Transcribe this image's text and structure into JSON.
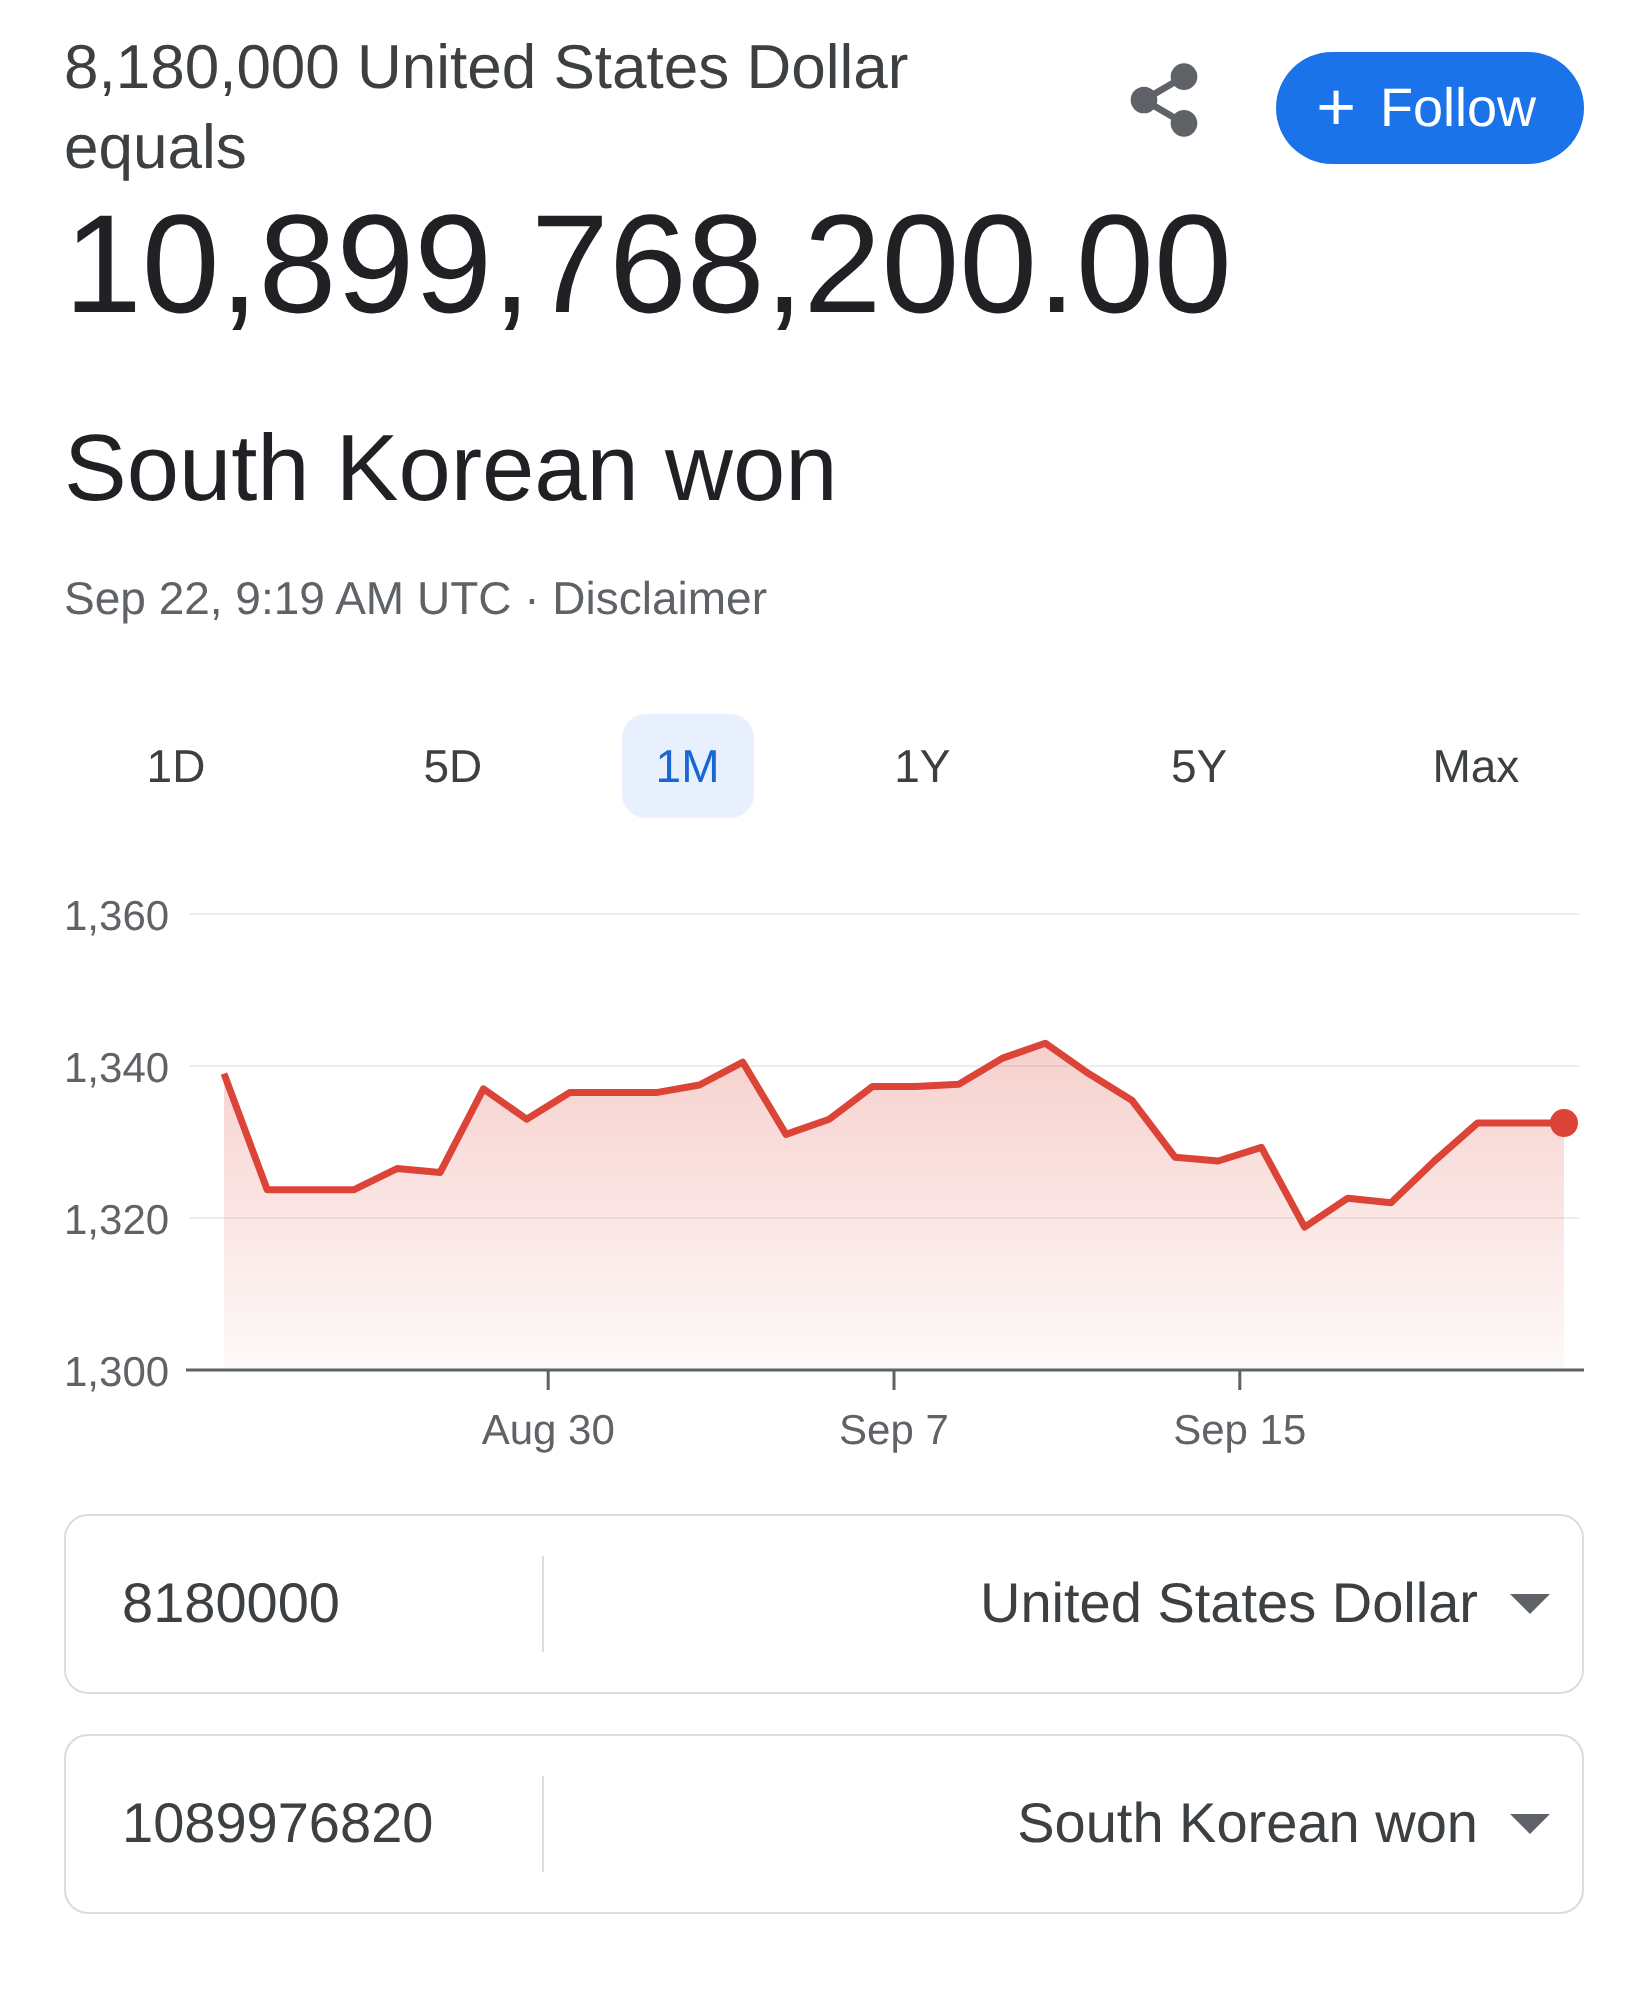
{
  "header": {
    "from_line": "8,180,000 United States Dollar",
    "equals": "equals",
    "result": "10,899,768,200.00",
    "to_currency": "South Korean won",
    "timestamp": "Sep 22, 9:19 AM UTC · ",
    "disclaimer": "Disclaimer",
    "follow": "Follow",
    "follow_symbol": "+"
  },
  "ranges": [
    {
      "label": "1D",
      "selected": false
    },
    {
      "label": "5D",
      "selected": false
    },
    {
      "label": "1M",
      "selected": true
    },
    {
      "label": "1Y",
      "selected": false
    },
    {
      "label": "5Y",
      "selected": false
    },
    {
      "label": "Max",
      "selected": false
    }
  ],
  "chart_data": {
    "type": "area",
    "categories": [
      null,
      null,
      null,
      null,
      null,
      null,
      null,
      null,
      null,
      null,
      null,
      null,
      null,
      null,
      null,
      "Aug 30",
      null,
      null,
      null,
      null,
      null,
      null,
      null,
      null,
      null,
      null,
      null,
      null,
      null,
      null,
      null,
      "Sep 7",
      null,
      null,
      null,
      null,
      null,
      null,
      null,
      null,
      null,
      null,
      null,
      null,
      null,
      null,
      null,
      "Sep 15",
      null,
      null,
      null,
      null,
      null,
      null,
      null,
      null,
      null,
      null,
      null,
      null,
      null,
      null,
      null
    ],
    "series": [
      {
        "color": "#db4437",
        "values": [
          1339,
          null,
          1323.7,
          null,
          null,
          null,
          1323.7,
          null,
          1326.5,
          null,
          1326,
          null,
          1337,
          null,
          1333,
          null,
          1336.5,
          null,
          null,
          null,
          1336.5,
          null,
          1337.5,
          null,
          1340.5,
          null,
          1331,
          null,
          1333,
          null,
          1337.3,
          null,
          1337.3,
          null,
          1337.6,
          null,
          1341,
          null,
          1343,
          null,
          1339,
          null,
          1335.5,
          null,
          1328,
          null,
          1327.5,
          null,
          1329.3,
          null,
          1318.8,
          null,
          1322.6,
          null,
          1322,
          null,
          1327.5,
          null,
          1332.5,
          null,
          null,
          null,
          1332.5
        ]
      }
    ],
    "ylim": [
      1300,
      1360
    ],
    "yticks": [
      {
        "value": 1360,
        "label": "1,360"
      },
      {
        "value": 1340,
        "label": "1,340"
      },
      {
        "value": 1320,
        "label": "1,320"
      },
      {
        "value": 1300,
        "label": "1,300"
      }
    ]
  },
  "converter": [
    {
      "amount": "8180000",
      "currency": "United States Dollar"
    },
    {
      "amount": "1089976820",
      "currency": "South Korean won"
    }
  ]
}
